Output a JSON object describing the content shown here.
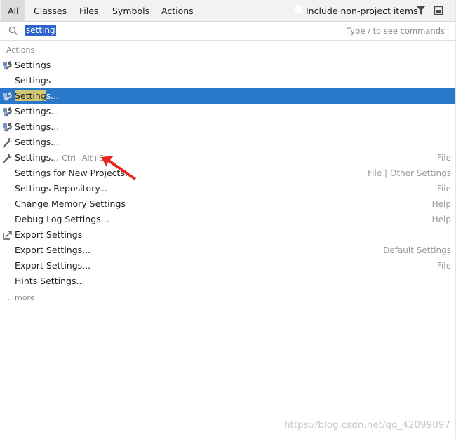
{
  "tabs": [
    {
      "label": "All",
      "active": true
    },
    {
      "label": "Classes",
      "active": false
    },
    {
      "label": "Files",
      "active": false
    },
    {
      "label": "Symbols",
      "active": false
    },
    {
      "label": "Actions",
      "active": false
    }
  ],
  "include_non_project": {
    "label": "Include non-project items",
    "checked": false
  },
  "search": {
    "value": "setting",
    "hint": "Type / to see commands"
  },
  "section": {
    "title": "Actions"
  },
  "rows": [
    {
      "label": "Settings",
      "icon": "settings-wrench-icon",
      "category": "",
      "shortcut": ""
    },
    {
      "label": "Settings",
      "icon": "",
      "category": "",
      "shortcut": ""
    },
    {
      "label": "Settings...",
      "icon": "settings-wrench-icon",
      "category": "",
      "shortcut": "",
      "selected": true
    },
    {
      "label": "Settings...",
      "icon": "settings-wrench-icon",
      "category": "",
      "shortcut": ""
    },
    {
      "label": "Settings...",
      "icon": "settings-wrench-icon",
      "category": "",
      "shortcut": ""
    },
    {
      "label": "Settings...",
      "icon": "wrench-icon",
      "category": "",
      "shortcut": ""
    },
    {
      "label": "Settings...",
      "icon": "wrench-icon",
      "category": "File",
      "shortcut": "Ctrl+Alt+S"
    },
    {
      "label": "Settings for New Projects...",
      "icon": "",
      "category": "File | Other Settings",
      "shortcut": ""
    },
    {
      "label": "Settings Repository...",
      "icon": "",
      "category": "File",
      "shortcut": ""
    },
    {
      "label": "Change Memory Settings",
      "icon": "",
      "category": "Help",
      "shortcut": ""
    },
    {
      "label": "Debug Log Settings...",
      "icon": "",
      "category": "Help",
      "shortcut": ""
    },
    {
      "label": "Export Settings",
      "icon": "export-icon",
      "category": "",
      "shortcut": ""
    },
    {
      "label": "Export Settings...",
      "icon": "",
      "category": "Default Settings",
      "shortcut": ""
    },
    {
      "label": "Export Settings...",
      "icon": "",
      "category": "File",
      "shortcut": ""
    },
    {
      "label": "Hints Settings...",
      "icon": "",
      "category": "",
      "shortcut": ""
    }
  ],
  "more": "... more",
  "watermark": "https://blog.csdn.net/qq_42099097",
  "colors": {
    "selection": "#2a78c9",
    "highlight": "#d2c878",
    "annotation_arrow": "#e8261c"
  }
}
